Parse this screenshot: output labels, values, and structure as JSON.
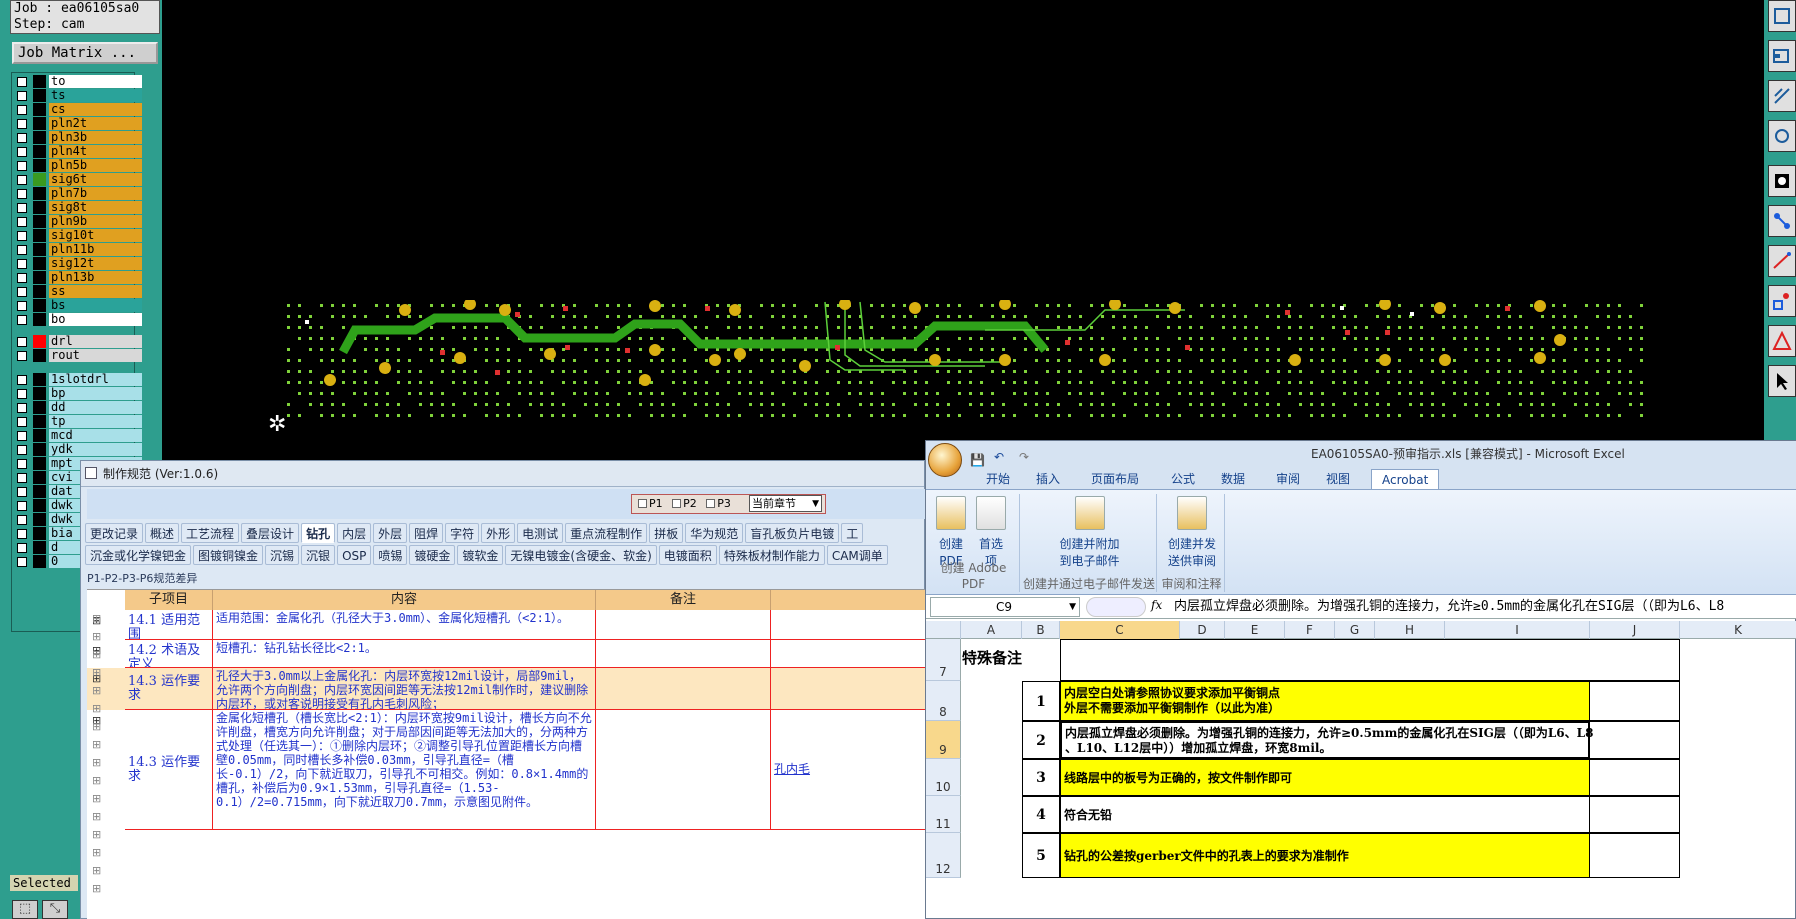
{
  "cam": {
    "job_label": "Job : ea06105sa0",
    "step_label": "Step: cam",
    "job_matrix_label": "Job Matrix ...",
    "selected_label": "Selected",
    "layers": [
      {
        "name": "to",
        "color": "#ffffff",
        "swatch": "#000000"
      },
      {
        "name": "ts",
        "color": "#2aa39a",
        "swatch": "#000000"
      },
      {
        "name": "cs",
        "color": "#e0a020",
        "swatch": "#000000"
      },
      {
        "name": "pln2t",
        "color": "#e0a020",
        "swatch": "#000000"
      },
      {
        "name": "pln3b",
        "color": "#e0a020",
        "swatch": "#000000"
      },
      {
        "name": "pln4t",
        "color": "#e0a020",
        "swatch": "#000000"
      },
      {
        "name": "pln5b",
        "color": "#e0a020",
        "swatch": "#000000"
      },
      {
        "name": "sig6t",
        "color": "#e0a020",
        "swatch": "#3a9a20"
      },
      {
        "name": "pln7b",
        "color": "#e0a020",
        "swatch": "#000000"
      },
      {
        "name": "sig8t",
        "color": "#e0a020",
        "swatch": "#000000"
      },
      {
        "name": "pln9b",
        "color": "#e0a020",
        "swatch": "#000000"
      },
      {
        "name": "sig10t",
        "color": "#e0a020",
        "swatch": "#000000"
      },
      {
        "name": "pln11b",
        "color": "#e0a020",
        "swatch": "#000000"
      },
      {
        "name": "sig12t",
        "color": "#e0a020",
        "swatch": "#000000"
      },
      {
        "name": "pln13b",
        "color": "#e0a020",
        "swatch": "#000000"
      },
      {
        "name": "ss",
        "color": "#e0a020",
        "swatch": "#000000"
      },
      {
        "name": "bs",
        "color": "#2aa39a",
        "swatch": "#000000"
      },
      {
        "name": "bo",
        "color": "#ffffff",
        "swatch": "#000000"
      },
      {
        "name": "drl",
        "color": "#d8d8d8",
        "swatch": "#ff0000"
      },
      {
        "name": "rout",
        "color": "#d8d8d8",
        "swatch": "#000000"
      },
      {
        "name": "1slotdrl",
        "color": "#a8e0e8",
        "swatch": "#000000"
      },
      {
        "name": "bp",
        "color": "#a8e0e8",
        "swatch": "#000000"
      },
      {
        "name": "dd",
        "color": "#a8e0e8",
        "swatch": "#000000"
      },
      {
        "name": "tp",
        "color": "#a8e0e8",
        "swatch": "#000000"
      },
      {
        "name": "mcd",
        "color": "#a8e0e8",
        "swatch": "#000000"
      },
      {
        "name": "ydk",
        "color": "#a8e0e8",
        "swatch": "#000000"
      },
      {
        "name": "mpt",
        "color": "#a8e0e8",
        "swatch": "#000000"
      },
      {
        "name": "cvi",
        "color": "#a8e0e8",
        "swatch": "#000000"
      },
      {
        "name": "dat",
        "color": "#a8e0e8",
        "swatch": "#000000"
      },
      {
        "name": "dwk",
        "color": "#a8e0e8",
        "swatch": "#000000"
      },
      {
        "name": "dwk",
        "color": "#a8e0e8",
        "swatch": "#000000"
      },
      {
        "name": "bia",
        "color": "#a8e0e8",
        "swatch": "#000000"
      },
      {
        "name": "d",
        "color": "#a8e0e8",
        "swatch": "#000000"
      },
      {
        "name": "0",
        "color": "#a8e0e8",
        "swatch": "#000000"
      }
    ]
  },
  "spec": {
    "title": "制作规范 (Ver:1.0.6)",
    "p_tabs": [
      "P1",
      "P2",
      "P3"
    ],
    "chapter_select": "当前章节",
    "tabs_row1": [
      "更改记录",
      "概述",
      "工艺流程",
      "叠层设计",
      "钻孔",
      "内层",
      "外层",
      "阻焊",
      "字符",
      "外形",
      "电测试",
      "重点流程制作",
      "拼板",
      "华为规范",
      "盲孔板负片电镀",
      "工"
    ],
    "active_tab": "钻孔",
    "tabs_row2": [
      "沉金或化学镍钯金",
      "图镀铜镍金",
      "沉锡",
      "沉银",
      "OSP",
      "喷锡",
      "镀硬金",
      "镀软金",
      "无镍电镀金(含硬金、软金)",
      "电镀面积",
      "特殊板材制作能力",
      "CAM调单"
    ],
    "breadcrumb": "P1-P2-P3-P6规范差异",
    "headers": [
      "子项目",
      "内容",
      "备注"
    ],
    "rows": [
      {
        "sub": "14.1 适用范围",
        "content": "适用范围：金属化孔（孔径大于3.0mm）、金属化短槽孔（<2:1）。",
        "note": "",
        "link": "",
        "highlight": false
      },
      {
        "sub": "14.2 术语及定义",
        "content": "短槽孔：钻孔钻长径比<2:1。",
        "note": "",
        "link": "",
        "highlight": false
      },
      {
        "sub": "14.3 运作要求",
        "content": "孔径大于3.0mm以上金属化孔：内层环宽按12mil设计，局部9mil，允许两个方向削盘；内层环宽因间距等无法按12mil制作时，建议删除内层环，或对客说明接受有孔内毛刺风险；",
        "note": "",
        "link": "",
        "highlight": true
      },
      {
        "sub": "14.3 运作要求",
        "content": "金属化短槽孔（槽长宽比<2:1）：内层环宽按9mil设计，槽长方向不允许削盘，槽宽方向允许削盘；对于局部因间距等无法加大的，分两种方式处理（任选其一）：①删除内层环；②调整引导孔位置距槽长方向槽壁0.05mm，同时槽长多补偿0.03mm，引导孔直径=（槽长-0.1）/2，向下就近取刀，引导孔不可相交。例如：0.8×1.4mm的槽孔，补偿后为0.9×1.53mm，引导孔直径=（1.53-0.1）/2=0.715mm，向下就近取刀0.7mm，示意图见附件。",
        "note": "",
        "link": "孔内毛",
        "highlight": false
      }
    ]
  },
  "excel": {
    "title": "EA06105SA0-预审指示.xls  [兼容模式] - Microsoft Excel",
    "tabs": [
      "开始",
      "插入",
      "页面布局",
      "公式",
      "数据",
      "审阅",
      "视图",
      "Acrobat"
    ],
    "active_tab": "Acrobat",
    "ribbon_buttons": [
      {
        "label1": "创建",
        "label2": "PDF"
      },
      {
        "label1": "首选",
        "label2": "项"
      },
      {
        "label1": "创建并附加",
        "label2": "到电子邮件"
      },
      {
        "label1": "创建并发",
        "label2": "送供审阅"
      }
    ],
    "ribbon_groups": [
      "创建 Adobe PDF",
      "创建并通过电子邮件发送",
      "审阅和注释"
    ],
    "name_box": "C9",
    "fx": "fx",
    "formula": "内层孤立焊盘必须删除。为增强孔铜的连接力，允许≥0.5mm的金属化孔在SIG层（（即为L6、L8",
    "columns": [
      "A",
      "B",
      "C",
      "D",
      "E",
      "F",
      "G",
      "H",
      "I",
      "J",
      "K"
    ],
    "selected_column": "C",
    "section_title": "特殊备注",
    "row_numbers": [
      "7",
      "8",
      "9",
      "10",
      "11",
      "12"
    ],
    "selected_row": "9",
    "items": [
      {
        "n": "1",
        "text1": "内层空白处请参照协议要求添加平衡铜点",
        "text2": "外层不需要添加平衡铜制作（以此为准）",
        "yellow": true
      },
      {
        "n": "2",
        "text1": "内层孤立焊盘必须删除。为增强孔铜的连接力，允许≥0.5mm的金属化孔在SIG层（（即为L6、L8",
        "text2": "、L10、L12层中））增加孤立焊盘，环宽8mil。",
        "yellow": false
      },
      {
        "n": "3",
        "text1": "线路层中的板号为正确的，按文件制作即可",
        "text2": "",
        "yellow": true
      },
      {
        "n": "4",
        "text1": "符合无铅",
        "text2": "",
        "yellow": false
      },
      {
        "n": "5",
        "text1": "钻孔的公差按gerber文件中的孔表上的要求为准制作",
        "text2": "",
        "yellow": true
      }
    ]
  }
}
